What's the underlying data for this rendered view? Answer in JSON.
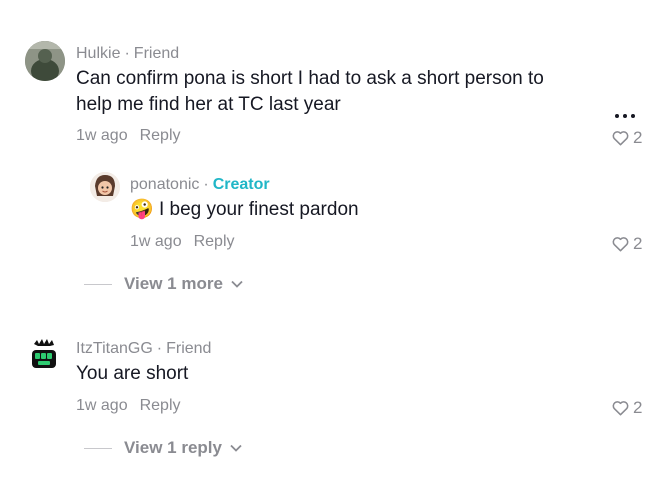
{
  "comments": [
    {
      "author": "Hulkie",
      "relation": "Friend",
      "text": "Can confirm pona is short I had to ask a short person to help me find her at TC last year",
      "age": "1w ago",
      "reply_label": "Reply",
      "likes": "2"
    },
    {
      "author": "ItzTitanGG",
      "relation": "Friend",
      "text": "You are short",
      "age": "1w ago",
      "reply_label": "Reply",
      "likes": "2"
    }
  ],
  "reply": {
    "author": "ponatonic",
    "badge": "Creator",
    "emoji": "🤪",
    "text": "I beg your finest pardon",
    "age": "1w ago",
    "reply_label": "Reply",
    "likes": "2"
  },
  "view_more_1": "View 1 more",
  "view_more_2": "View 1 reply",
  "separator": "·",
  "colors": {
    "creator": "#20b6c7",
    "muted": "#8a8b91",
    "text": "#161823"
  }
}
